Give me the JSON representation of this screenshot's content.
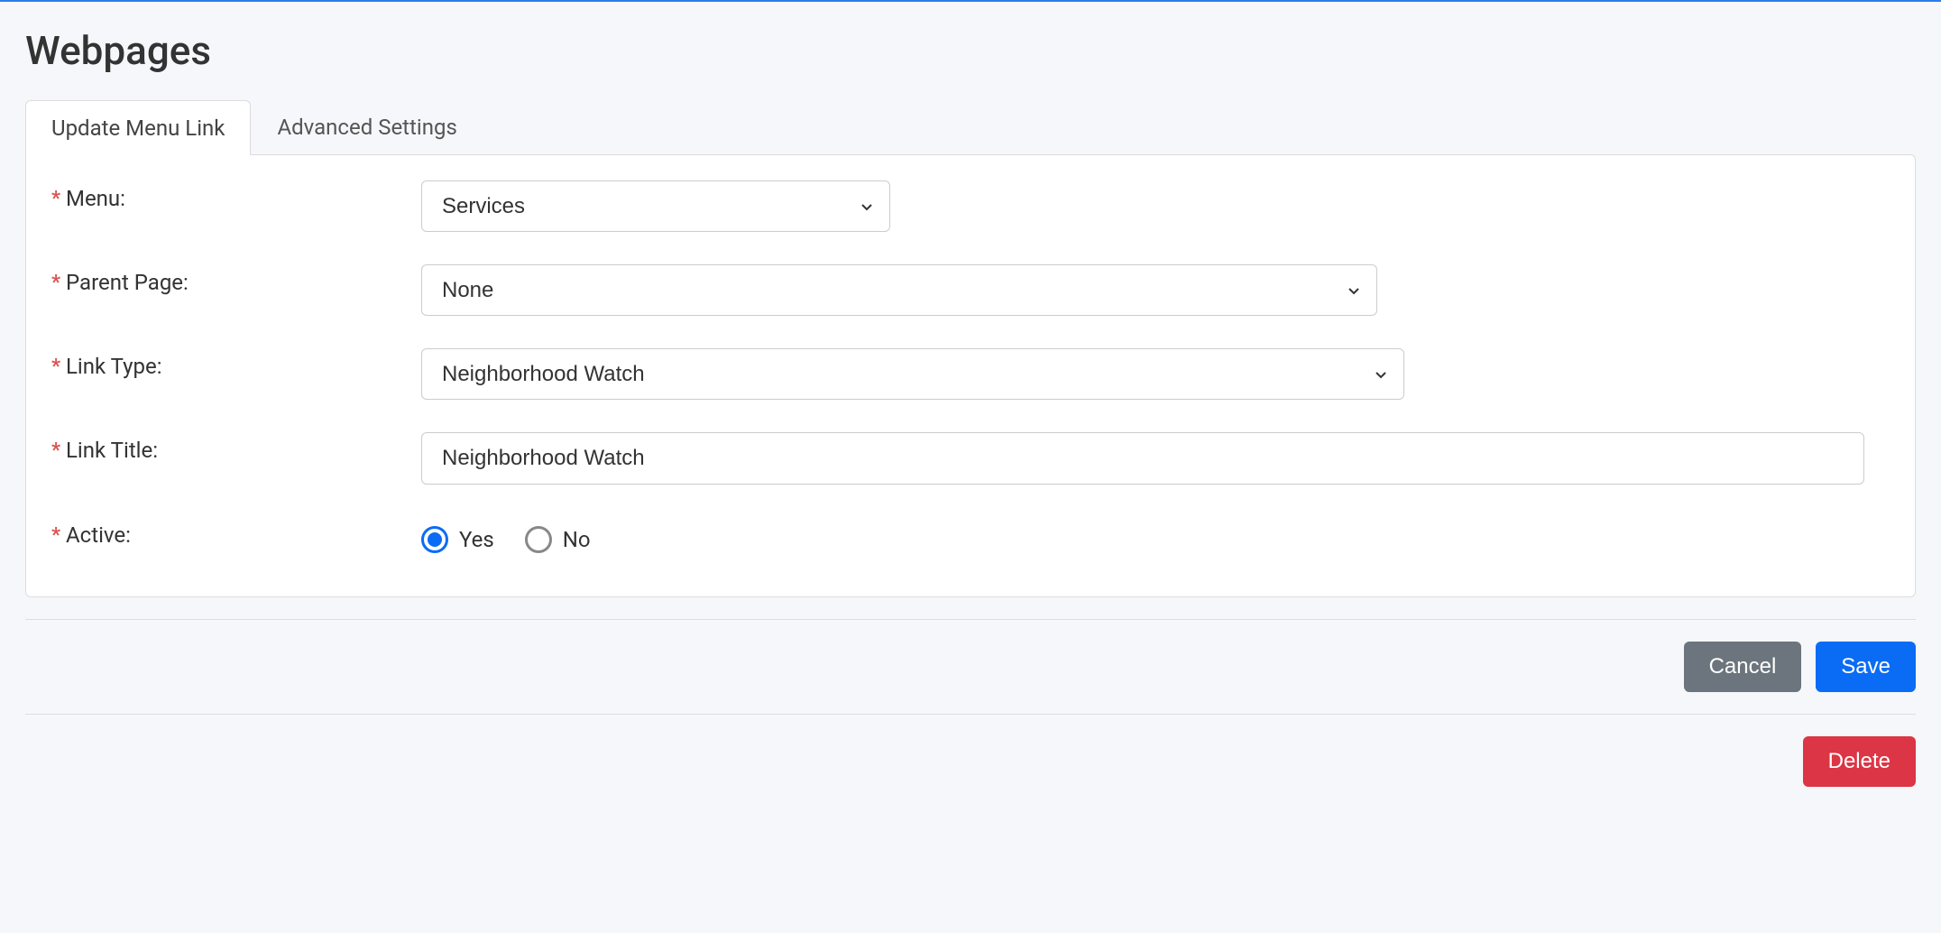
{
  "page_title": "Webpages",
  "tabs": [
    {
      "label": "Update Menu Link",
      "active": true
    },
    {
      "label": "Advanced Settings",
      "active": false
    }
  ],
  "fields": {
    "menu": {
      "label": "Menu:",
      "value": "Services"
    },
    "parent_page": {
      "label": "Parent Page:",
      "value": "None"
    },
    "link_type": {
      "label": "Link Type:",
      "value": "Neighborhood Watch"
    },
    "link_title": {
      "label": "Link Title:",
      "value": "Neighborhood Watch"
    },
    "active": {
      "label": "Active:",
      "options": [
        {
          "label": "Yes",
          "selected": true
        },
        {
          "label": "No",
          "selected": false
        }
      ]
    }
  },
  "buttons": {
    "cancel": "Cancel",
    "save": "Save",
    "delete": "Delete"
  }
}
